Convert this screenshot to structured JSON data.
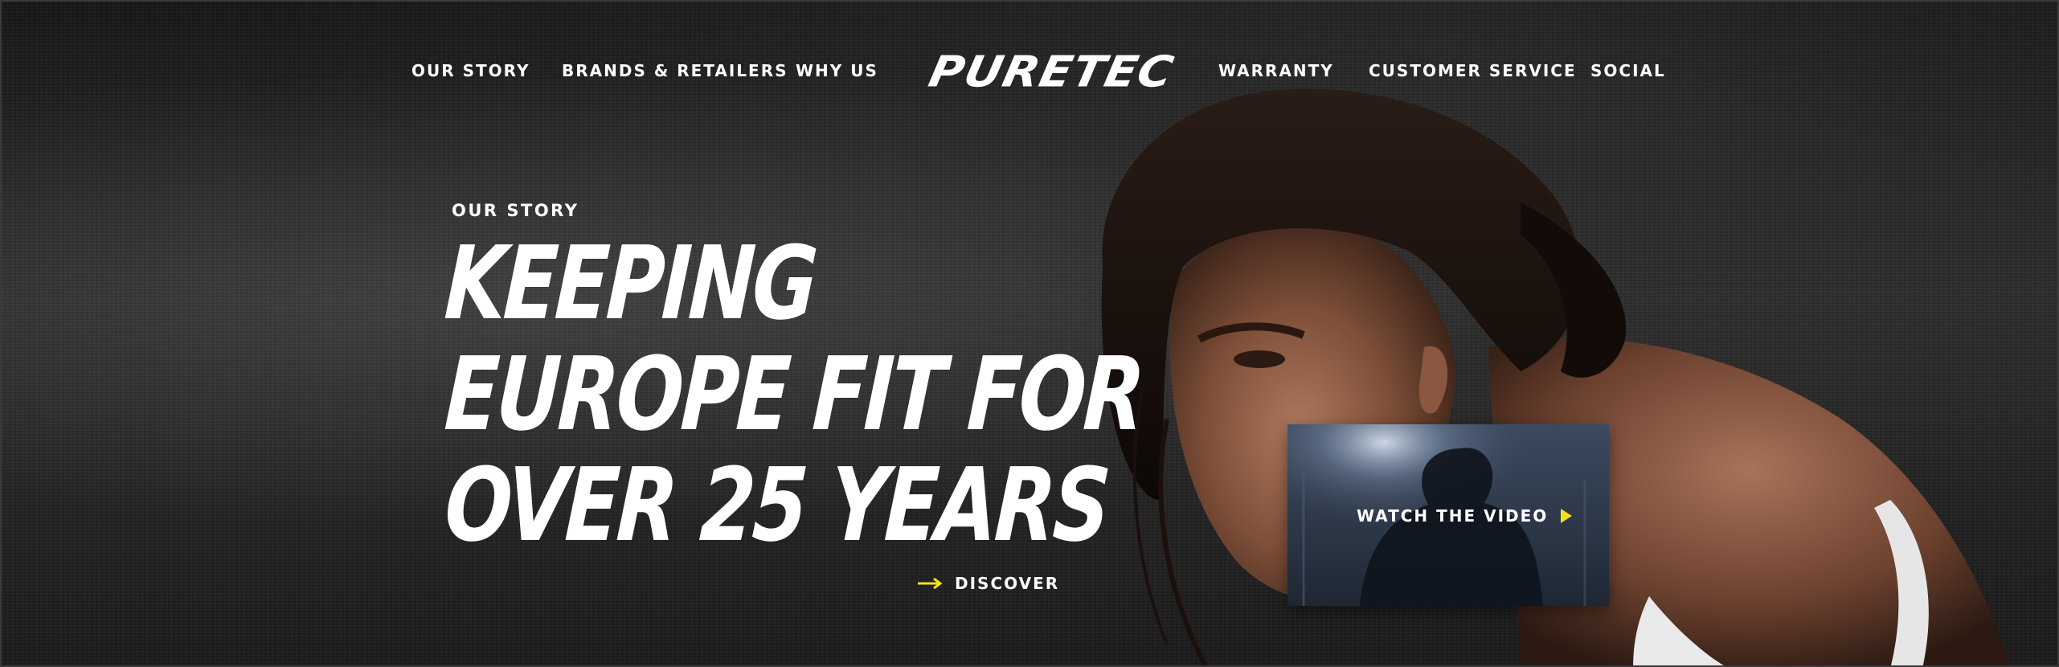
{
  "nav": {
    "left": [
      "OUR STORY",
      "BRANDS & RETAILERS",
      "WHY US"
    ],
    "logo": "PURETEC",
    "right": [
      "WARRANTY",
      "CUSTOMER SERVICE",
      "SOCIAL"
    ]
  },
  "hero": {
    "eyebrow": "OUR STORY",
    "headline": [
      "KEEPING",
      "EUROPE FIT FOR",
      "OVER 25 YEARS"
    ],
    "discover": "DISCOVER",
    "video_label": "WATCH THE VIDEO"
  },
  "colors": {
    "accent": "#f2e21a",
    "text": "#ffffff",
    "background": "#1e1e1e"
  },
  "icons": {
    "discover": "arrow-right-icon",
    "video": "play-icon"
  }
}
